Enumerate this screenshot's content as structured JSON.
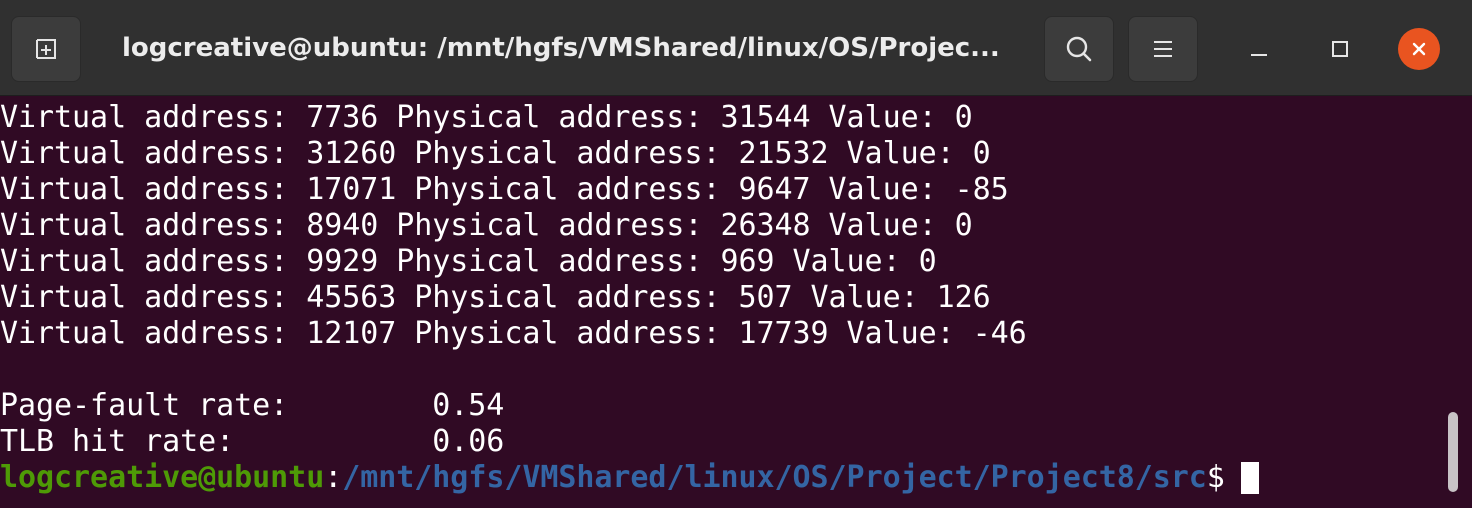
{
  "titlebar": {
    "title": "logcreative@ubuntu: /mnt/hgfs/VMShared/linux/OS/Projec..."
  },
  "terminal": {
    "lines": [
      "Virtual address: 7736 Physical address: 31544 Value: 0",
      "Virtual address: 31260 Physical address: 21532 Value: 0",
      "Virtual address: 17071 Physical address: 9647 Value: -85",
      "Virtual address: 8940 Physical address: 26348 Value: 0",
      "Virtual address: 9929 Physical address: 969 Value: 0",
      "Virtual address: 45563 Physical address: 507 Value: 126",
      "Virtual address: 12107 Physical address: 17739 Value: -46",
      "",
      "Page-fault rate:        0.54",
      "TLB hit rate:           0.06"
    ],
    "prompt": {
      "user_host": "logcreative@ubuntu",
      "colon": ":",
      "path": "/mnt/hgfs/VMShared/linux/OS/Project/Project8/src",
      "dollar": "$ "
    }
  },
  "icons": {
    "new_tab": "new-tab-icon",
    "search": "search-icon",
    "menu": "hamburger-menu-icon",
    "minimize": "minimize-icon",
    "maximize": "maximize-icon",
    "close": "close-icon"
  },
  "colors": {
    "terminal_bg": "#300a24",
    "titlebar_bg": "#303030",
    "prompt_user": "#4e9a06",
    "prompt_path": "#3465a4",
    "close_button": "#e95420"
  }
}
